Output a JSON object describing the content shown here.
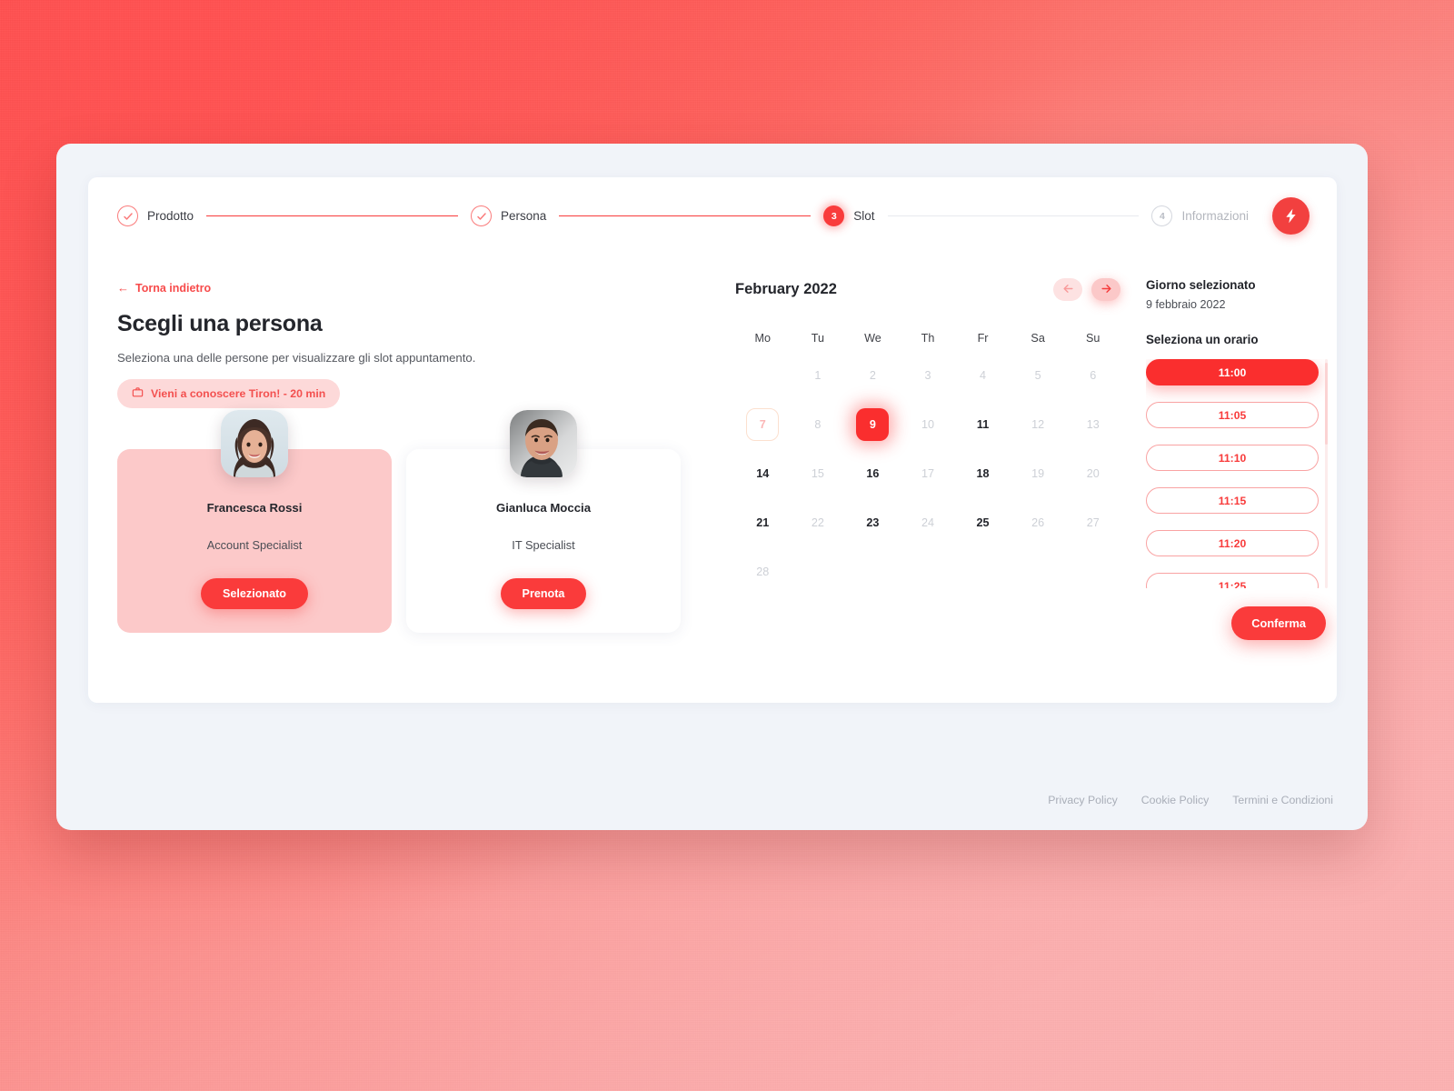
{
  "stepper": {
    "steps": [
      {
        "label": "Prodotto",
        "state": "done",
        "marker": "check"
      },
      {
        "label": "Persona",
        "state": "done",
        "marker": "check"
      },
      {
        "label": "Slot",
        "state": "current",
        "marker": "3"
      },
      {
        "label": "Informazioni",
        "state": "todo",
        "marker": "4"
      }
    ],
    "brand_icon": "lightning-bolt-icon"
  },
  "left": {
    "back_label": "Torna indietro",
    "back_icon": "arrow-left-icon",
    "title": "Scegli una persona",
    "subtitle": "Seleziona una delle persone per visualizzare gli slot appuntamento.",
    "tag": {
      "icon": "briefcase-icon",
      "label": "Vieni a conoscere Tiron! - 20 min"
    },
    "people": [
      {
        "name": "Francesca Rossi",
        "role": "Account Specialist",
        "button": "Selezionato",
        "selected": true,
        "avatar": "woman-portrait-avatar"
      },
      {
        "name": "Gianluca Moccia",
        "role": "IT Specialist",
        "button": "Prenota",
        "selected": false,
        "avatar": "man-portrait-avatar"
      }
    ]
  },
  "calendar": {
    "month_label": "February 2022",
    "prev_icon": "arrow-left-icon",
    "next_icon": "arrow-right-icon",
    "day_headers": [
      "Mo",
      "Tu",
      "We",
      "Th",
      "Fr",
      "Sa",
      "Su"
    ],
    "weeks": [
      [
        {
          "label": "",
          "state": "empty"
        },
        {
          "label": "1",
          "state": "muted"
        },
        {
          "label": "2",
          "state": "muted"
        },
        {
          "label": "3",
          "state": "muted"
        },
        {
          "label": "4",
          "state": "muted"
        },
        {
          "label": "5",
          "state": "muted"
        },
        {
          "label": "6",
          "state": "muted"
        }
      ],
      [
        {
          "label": "7",
          "state": "today"
        },
        {
          "label": "8",
          "state": "muted"
        },
        {
          "label": "9",
          "state": "selected"
        },
        {
          "label": "10",
          "state": "muted"
        },
        {
          "label": "11",
          "state": "avail"
        },
        {
          "label": "12",
          "state": "muted"
        },
        {
          "label": "13",
          "state": "muted"
        }
      ],
      [
        {
          "label": "14",
          "state": "avail"
        },
        {
          "label": "15",
          "state": "muted"
        },
        {
          "label": "16",
          "state": "avail"
        },
        {
          "label": "17",
          "state": "muted"
        },
        {
          "label": "18",
          "state": "avail"
        },
        {
          "label": "19",
          "state": "muted"
        },
        {
          "label": "20",
          "state": "muted"
        }
      ],
      [
        {
          "label": "21",
          "state": "avail"
        },
        {
          "label": "22",
          "state": "muted"
        },
        {
          "label": "23",
          "state": "avail"
        },
        {
          "label": "24",
          "state": "muted"
        },
        {
          "label": "25",
          "state": "avail"
        },
        {
          "label": "26",
          "state": "muted"
        },
        {
          "label": "27",
          "state": "muted"
        }
      ],
      [
        {
          "label": "28",
          "state": "muted"
        },
        {
          "label": "",
          "state": "empty"
        },
        {
          "label": "",
          "state": "empty"
        },
        {
          "label": "",
          "state": "empty"
        },
        {
          "label": "",
          "state": "empty"
        },
        {
          "label": "",
          "state": "empty"
        },
        {
          "label": "",
          "state": "empty"
        }
      ]
    ]
  },
  "slots": {
    "selected_day_label": "Giorno selezionato",
    "selected_day_value": "9 febbraio 2022",
    "pick_time_label": "Seleziona un orario",
    "times": [
      {
        "label": "11:00",
        "selected": true
      },
      {
        "label": "11:05",
        "selected": false
      },
      {
        "label": "11:10",
        "selected": false
      },
      {
        "label": "11:15",
        "selected": false
      },
      {
        "label": "11:20",
        "selected": false
      },
      {
        "label": "11:25",
        "selected": false
      }
    ],
    "confirm_label": "Conferma"
  },
  "footer": {
    "links": [
      "Privacy Policy",
      "Cookie Policy",
      "Termini e Condizioni"
    ]
  },
  "colors": {
    "accent": "#fa3b3b",
    "accent_soft": "#fcc9c9",
    "page_bg": "#f1f4f9",
    "text_dark": "#23252b",
    "text_muted": "#a9aeb8"
  }
}
